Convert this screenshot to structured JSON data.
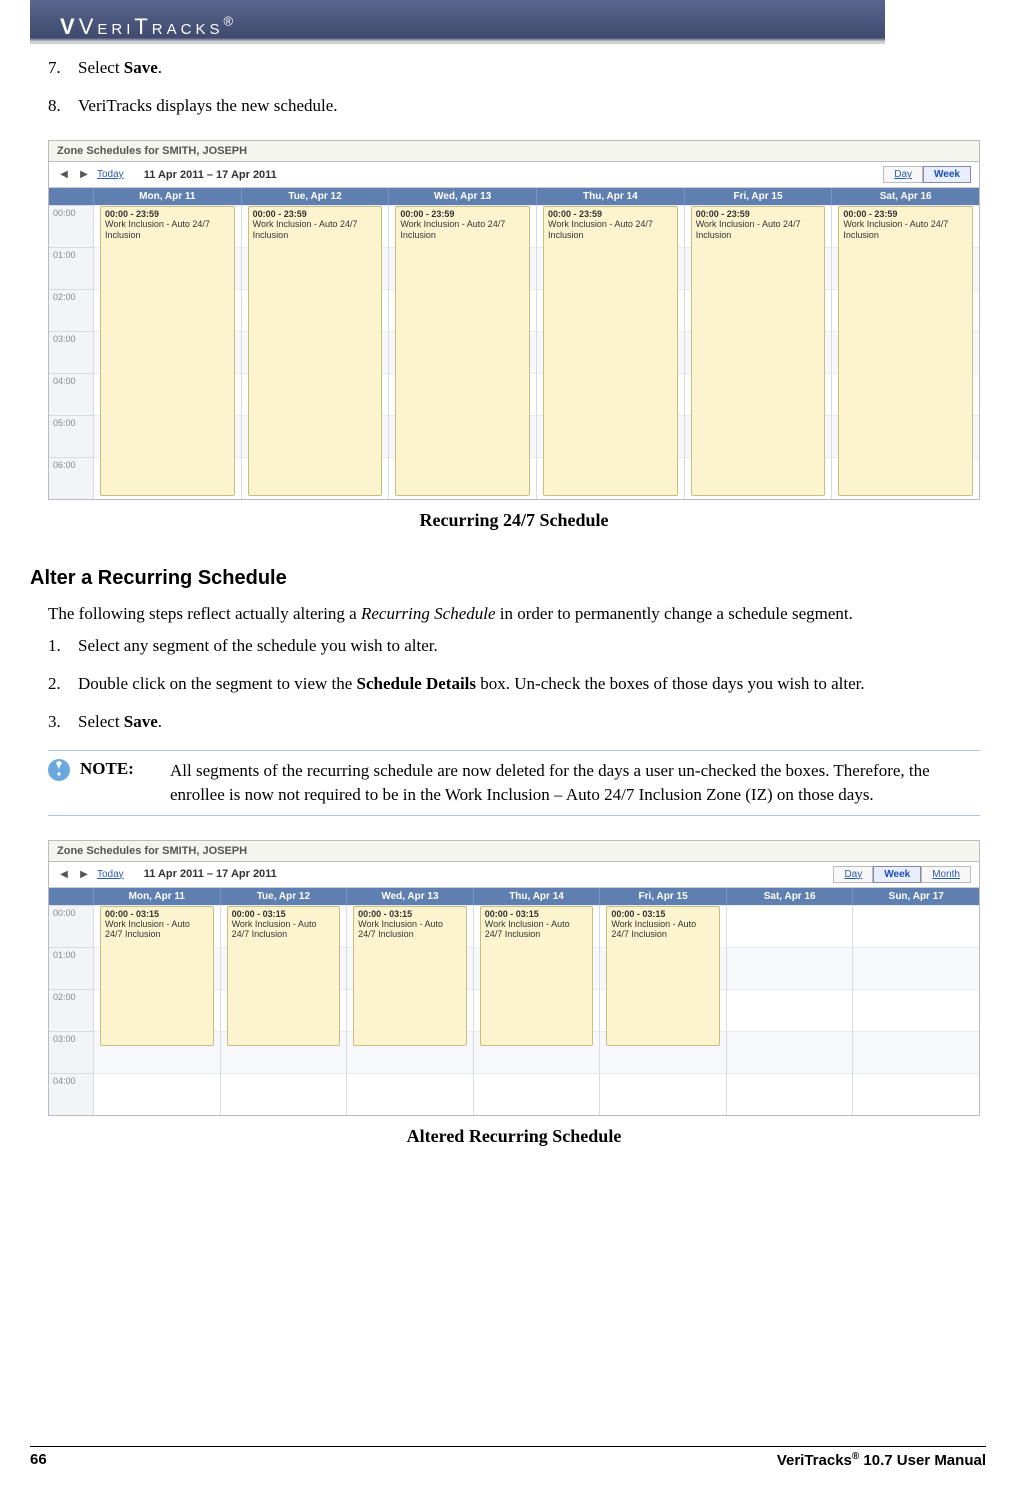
{
  "brand": {
    "name": "VeriTracks",
    "reg": "®"
  },
  "steps_top": [
    {
      "num": "7.",
      "pre": "Select ",
      "bold": "Save",
      "post": "."
    },
    {
      "num": "8.",
      "pre": "VeriTracks displays the new schedule.",
      "bold": "",
      "post": ""
    }
  ],
  "calendar1": {
    "title": "Zone Schedules for SMITH, JOSEPH",
    "today": "Today",
    "range": "11 Apr 2011 – 17 Apr 2011",
    "day": "Day",
    "week": "Week",
    "days": [
      "Mon, Apr 11",
      "Tue, Apr 12",
      "Wed, Apr 13",
      "Thu, Apr 14",
      "Fri, Apr 15",
      "Sat, Apr 16"
    ],
    "times": [
      "00:00",
      "01:00",
      "02:00",
      "03:00",
      "04:00",
      "05:00",
      "06:00"
    ],
    "event": {
      "time": "00:00 - 23:59",
      "title": "Work Inclusion - Auto 24/7 Inclusion"
    },
    "event_days": 6,
    "event_height": 290
  },
  "caption1": "Recurring 24/7 Schedule",
  "section2": "Alter a Recurring Schedule",
  "para2_a": "The following steps reflect actually altering a ",
  "para2_i": "Recurring Schedule",
  "para2_b": " in order to permanently change a schedule segment.",
  "alter_steps": [
    {
      "num": "1.",
      "text": "Select any segment of the schedule you wish to alter."
    },
    {
      "num": "2.",
      "pre": "Double click on the segment to view the ",
      "bold": "Schedule Details",
      "post": " box.  Un-check the boxes of those days you wish to alter."
    },
    {
      "num": "3.",
      "pre": "Select ",
      "bold": "Save",
      "post": "."
    }
  ],
  "note": {
    "label": "NOTE:",
    "body": "All segments of the recurring schedule are now deleted for the days a user un-checked the boxes. Therefore, the enrollee is now not required to be in the Work Inclusion – Auto 24/7 Inclusion Zone (IZ) on those days."
  },
  "calendar2": {
    "title": "Zone Schedules for SMITH, JOSEPH",
    "today": "Today",
    "range": "11 Apr 2011 – 17 Apr 2011",
    "day": "Day",
    "week": "Week",
    "month": "Month",
    "days": [
      "Mon, Apr 11",
      "Tue, Apr 12",
      "Wed, Apr 13",
      "Thu, Apr 14",
      "Fri, Apr 15",
      "Sat, Apr 16",
      "Sun, Apr 17"
    ],
    "times": [
      "00:00",
      "01:00",
      "02:00",
      "03:00",
      "04:00"
    ],
    "event": {
      "time": "00:00 - 03:15",
      "title": "Work Inclusion - Auto 24/7 Inclusion"
    },
    "event_days": 5,
    "event_height": 140
  },
  "caption2": "Altered Recurring Schedule",
  "footer": {
    "page": "66",
    "manual": "VeriTracks® 10.7 User Manual",
    "manual_pre": "VeriTracks",
    "manual_sup": "®",
    "manual_post": " 10.7 User Manual"
  }
}
